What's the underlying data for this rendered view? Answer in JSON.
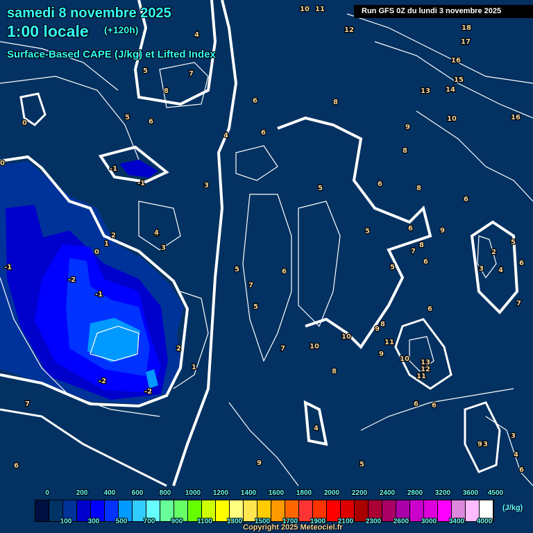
{
  "header": {
    "date": "samedi 8 novembre 2025",
    "time": "1:00 locale",
    "lead": "(+120h)",
    "parameter": "Surface-Based CAPE (J/kg) et Lifted Index",
    "run": "Run GFS 0Z du lundi 3 novembre 2025"
  },
  "colors": {
    "background": "#033161",
    "contour": "#ffffff",
    "cape_layers": [
      "#003399",
      "#0000cc",
      "#0000ff",
      "#0033ff",
      "#0099ff"
    ]
  },
  "contour_labels": [
    "0",
    "-1",
    "-1",
    "-1",
    "-2",
    "-1",
    "-2",
    "-2",
    "0",
    "1",
    "2",
    "3",
    "4",
    "3",
    "2",
    "1",
    "4",
    "5",
    "5",
    "6",
    "7",
    "8",
    "4",
    "6",
    "5",
    "6",
    "8",
    "9",
    "10",
    "11",
    "12",
    "13",
    "14",
    "15",
    "16",
    "17",
    "18",
    "10",
    "16",
    "8",
    "8",
    "6",
    "6",
    "5",
    "6",
    "8",
    "9",
    "7",
    "6",
    "2",
    "3",
    "4",
    "5",
    "6",
    "7",
    "6",
    "5",
    "8",
    "9",
    "10",
    "10",
    "11",
    "9",
    "10",
    "13",
    "12",
    "11",
    "6",
    "6",
    "5",
    "4",
    "8",
    "9",
    "3",
    "3",
    "4",
    "6",
    "5",
    "9",
    "7",
    "6",
    "7",
    "5",
    "4",
    "0",
    "7",
    "6"
  ],
  "legend": {
    "top_labels": [
      "0",
      "200",
      "400",
      "600",
      "800",
      "1000",
      "1200",
      "1400",
      "1600",
      "1800",
      "2000",
      "2200",
      "2400",
      "2800",
      "3200",
      "3600",
      "4500"
    ],
    "bottom_labels": [
      "100",
      "300",
      "500",
      "700",
      "900",
      "1100",
      "1300",
      "1500",
      "1700",
      "1900",
      "2100",
      "2300",
      "2600",
      "3000",
      "3400",
      "4000"
    ],
    "colors": [
      "#001040",
      "#003366",
      "#003399",
      "#0000cc",
      "#0000ff",
      "#0033ff",
      "#0099ff",
      "#33ccff",
      "#66ffff",
      "#66ff99",
      "#66ff66",
      "#66ff00",
      "#ccff00",
      "#ffff00",
      "#ffff80",
      "#ffe650",
      "#ffcc00",
      "#ff9900",
      "#ff6600",
      "#ff3333",
      "#ff3300",
      "#ff0000",
      "#dd0000",
      "#aa0000",
      "#aa0033",
      "#aa0066",
      "#aa00aa",
      "#cc00cc",
      "#dd00dd",
      "#ff00ff",
      "#dd88dd",
      "#ffbbff",
      "#ffffff"
    ],
    "unit": "(J/kg)"
  },
  "copyright": "Copyright 2025 Meteociel.fr"
}
